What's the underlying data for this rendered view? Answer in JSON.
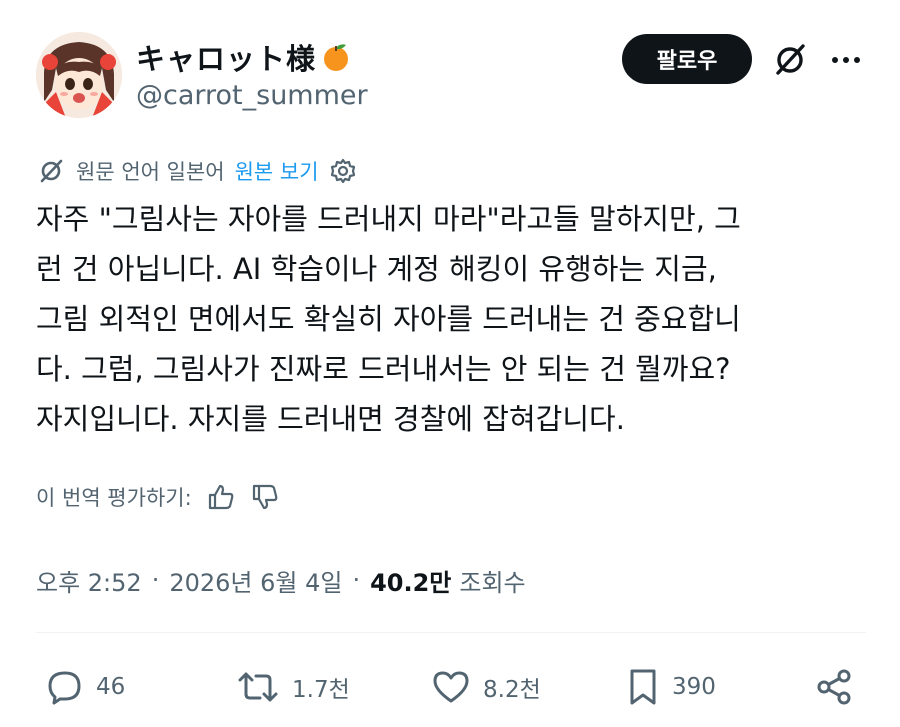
{
  "author": {
    "display_name": "キャロット様",
    "emoji": "orange-emoji",
    "handle": "@carrot_summer"
  },
  "header": {
    "follow_label": "팔로우",
    "grok_icon": "grok-icon",
    "more_label": "···"
  },
  "translation": {
    "notice": "원문 언어 일본어",
    "show_original_label": "원본 보기",
    "link_color": "#1d9bf0"
  },
  "tweet": {
    "lines": [
      "자주 \"그림사는 자아를 드러내지 마라\"라고들 말하지만, 그",
      "런 건 아닙니다. AI 학습이나 계정 해킹이 유행하는 지금,",
      "그림 외적인 면에서도 확실히 자아를 드러내는 건 중요합니",
      "다. 그럼, 그림사가 진짜로 드러내서는 안 되는 건 뭘까요?",
      "자지입니다. 자지를 드러내면 경찰에 잡혀갑니다."
    ]
  },
  "rate": {
    "label": "이 번역 평가하기:"
  },
  "meta": {
    "time": "오후 2:52",
    "date": "2026년 6월 4일",
    "views_count": "40.2만",
    "views_label": "조회수"
  },
  "actions": {
    "replies": "46",
    "reposts": "1.7천",
    "likes": "8.2천",
    "bookmarks": "390"
  },
  "colors": {
    "text": "#0f1419",
    "secondary": "#536471",
    "follow_bg": "#0f1419",
    "accent": "#1d9bf0"
  }
}
